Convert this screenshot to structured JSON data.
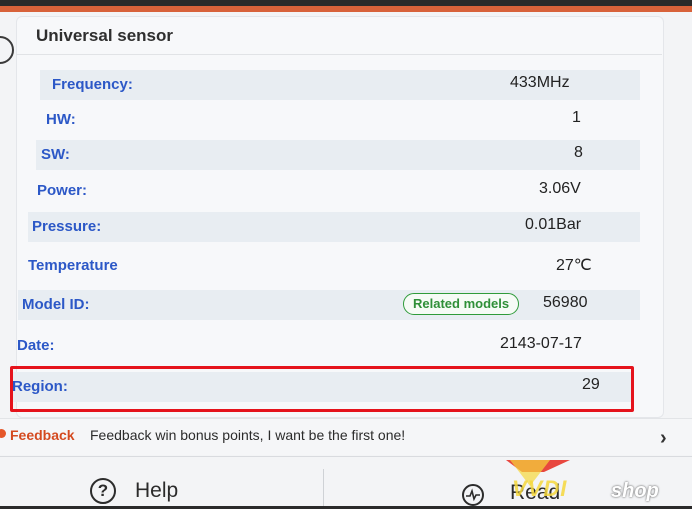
{
  "header": {
    "title": "Universal sensor"
  },
  "rows": [
    {
      "label": "Frequency:",
      "value": "433MHz"
    },
    {
      "label": "HW:",
      "value": "1"
    },
    {
      "label": "SW:",
      "value": "8"
    },
    {
      "label": "Power:",
      "value": "3.06V"
    },
    {
      "label": "Pressure:",
      "value": "0.01Bar"
    },
    {
      "label": "Temperature",
      "value": "27℃"
    },
    {
      "label": "Model ID:",
      "value": "56980",
      "badge": "Related models"
    },
    {
      "label": "Date:",
      "value": "2143-07-17"
    },
    {
      "label": "Region:",
      "value": "29"
    }
  ],
  "feedback": {
    "tag": "Feedback",
    "text": "Feedback win bonus points, I want be the first one!",
    "chevron": "›"
  },
  "bottom": {
    "help_label": "Help",
    "help_icon": "?",
    "read_label": "Read"
  },
  "watermark": {
    "brand": "VVDI",
    "suffix": "shop"
  },
  "colors": {
    "label": "#2c58c7",
    "highlight": "#e5131c",
    "badge": "#2f9b3a",
    "feedback": "#d44a20"
  }
}
